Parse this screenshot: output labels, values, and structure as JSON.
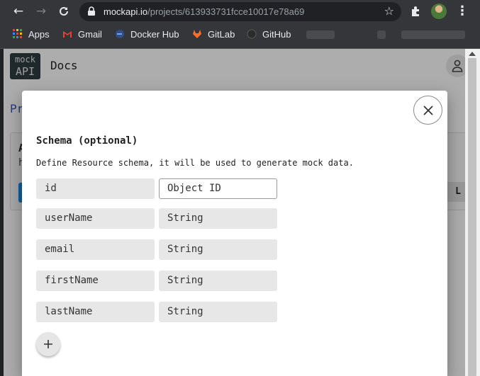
{
  "browser": {
    "url_host": "mockapi.io",
    "url_path": "/projects/613933731fcce10017e78a69",
    "bookmarks": [
      {
        "label": "Apps",
        "icon": "apps-grid-icon"
      },
      {
        "label": "Gmail",
        "icon": "gmail-icon"
      },
      {
        "label": "Docker Hub",
        "icon": "docker-icon"
      },
      {
        "label": "GitLab",
        "icon": "gitlab-icon"
      },
      {
        "label": "GitHub",
        "icon": "github-icon"
      }
    ]
  },
  "page": {
    "logo_line1": "mock",
    "logo_line2": "API",
    "nav_docs": "Docs",
    "breadcrumb_partial": "Pr",
    "card_line1": "A",
    "card_line2": "h",
    "card_button_partial": "L"
  },
  "modal": {
    "title": "Schema (optional)",
    "description": "Define Resource schema, it will be used to generate mock data.",
    "fields": [
      {
        "name": "id",
        "type": "Object ID"
      },
      {
        "name": "userName",
        "type": "String"
      },
      {
        "name": "email",
        "type": "String"
      },
      {
        "name": "firstName",
        "type": "String"
      },
      {
        "name": "lastName",
        "type": "String"
      }
    ]
  },
  "colors": {
    "link": "#3f51b5",
    "primary": "#1e88e5",
    "chrome": "#35363a"
  }
}
